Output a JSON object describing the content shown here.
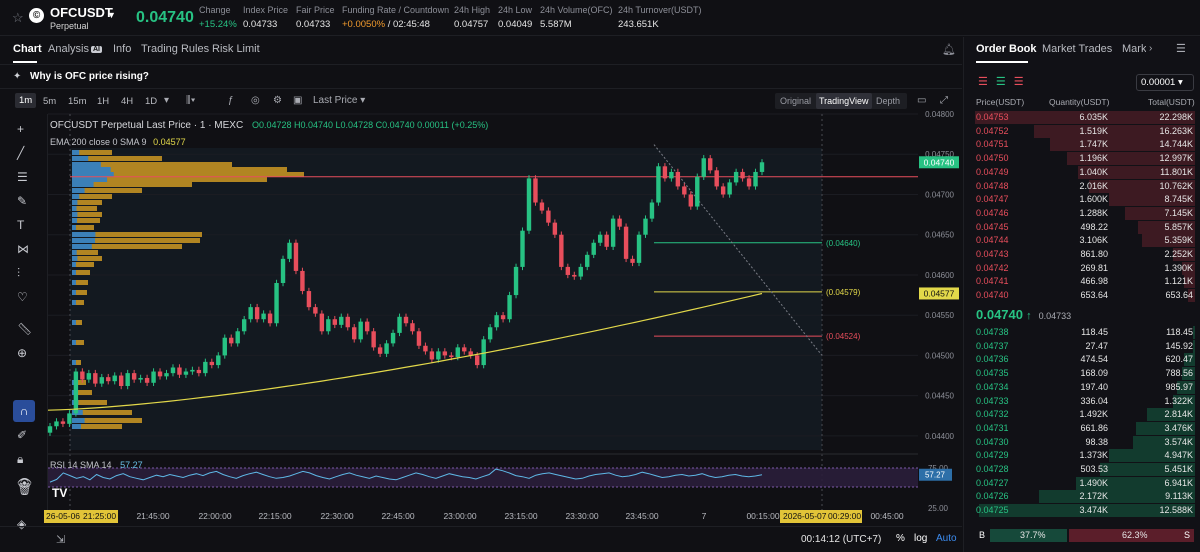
{
  "ticker": {
    "symbol": "OFCUSDT",
    "subtitle": "Perpetual",
    "last_price": "0.04740",
    "stats": [
      {
        "label": "Change",
        "value": "+15.24%",
        "tone": "green"
      },
      {
        "label": "Index Price",
        "value": "0.04733",
        "tone": ""
      },
      {
        "label": "Fair Price",
        "value": "0.04733",
        "tone": ""
      },
      {
        "label": "Funding Rate / Countdown",
        "value": "+0.0050%",
        "value2": "/ 02:45:48",
        "tone": "orange"
      },
      {
        "label": "24h High",
        "value": "0.04757",
        "tone": ""
      },
      {
        "label": "24h Low",
        "value": "0.04049",
        "tone": ""
      },
      {
        "label": "24h Volume(OFC)",
        "value": "5.587M",
        "tone": ""
      },
      {
        "label": "24h Turnover(USDT)",
        "value": "243.651K",
        "tone": ""
      }
    ]
  },
  "chart_tabs": [
    "Chart",
    "Analysis",
    "Info",
    "Trading Rules",
    "Risk Limit"
  ],
  "ai_badge": "AI",
  "info_banner": "Why is OFC price rising?",
  "timeframes": [
    "1m",
    "5m",
    "15m",
    "1H",
    "4H",
    "1D"
  ],
  "price_type": "Last Price",
  "views": [
    "Original",
    "TradingView",
    "Depth"
  ],
  "legend": {
    "title": "OFCUSDT Perpetual Last Price · 1 · MEXC",
    "ohlc": "O0.04728  H0.04740  L0.04728  C0.04740  0.00011 (+0.25%)",
    "ema_label": "EMA 200 close 0 SMA 9",
    "ema_value": "0.04577"
  },
  "rsi": {
    "label": "RSI 14 SMA 14",
    "value": "57.27"
  },
  "chart_data": {
    "type": "candlestick",
    "y_axis_ticks": [
      "0.04800",
      "0.04750",
      "0.04700",
      "0.04650",
      "0.04600",
      "0.04550",
      "0.04500",
      "0.04450",
      "0.04400"
    ],
    "ylim": [
      0.0438,
      0.048
    ],
    "x_axis_ticks": [
      "21:45:00",
      "22:00:00",
      "22:15:00",
      "22:30:00",
      "22:45:00",
      "23:00:00",
      "23:15:00",
      "23:30:00",
      "23:45:00",
      "7",
      "00:15:00",
      "00:45:00"
    ],
    "x_start_label": "26-05-06",
    "x_start_time": "21:25:00",
    "x_cursor_label": "2026-05-07",
    "x_cursor_time": "00:29:00",
    "closes": [
      0.04412,
      0.04418,
      0.04415,
      0.04428,
      0.0448,
      0.0447,
      0.04478,
      0.04465,
      0.04473,
      0.04468,
      0.04475,
      0.04462,
      0.04478,
      0.0447,
      0.04472,
      0.04466,
      0.0448,
      0.04474,
      0.04478,
      0.04485,
      0.04476,
      0.0448,
      0.04482,
      0.04478,
      0.04492,
      0.04488,
      0.045,
      0.04522,
      0.04515,
      0.0453,
      0.04545,
      0.0456,
      0.04545,
      0.04552,
      0.0454,
      0.0459,
      0.0462,
      0.0464,
      0.04605,
      0.0458,
      0.0456,
      0.04552,
      0.0453,
      0.04545,
      0.04538,
      0.04548,
      0.04535,
      0.0452,
      0.04542,
      0.0453,
      0.0451,
      0.04502,
      0.04515,
      0.04528,
      0.04548,
      0.0454,
      0.0453,
      0.04512,
      0.04505,
      0.04495,
      0.04505,
      0.045,
      0.04498,
      0.0451,
      0.04505,
      0.045,
      0.04488,
      0.0452,
      0.04535,
      0.0455,
      0.04545,
      0.04575,
      0.0461,
      0.04655,
      0.0472,
      0.0469,
      0.0468,
      0.04665,
      0.0465,
      0.0461,
      0.046,
      0.04598,
      0.0461,
      0.04625,
      0.0464,
      0.0465,
      0.04635,
      0.0467,
      0.0466,
      0.0462,
      0.04615,
      0.0465,
      0.0467,
      0.0469,
      0.04735,
      0.0472,
      0.04728,
      0.0471,
      0.047,
      0.04685,
      0.04722,
      0.04745,
      0.0473,
      0.0471,
      0.047,
      0.04715,
      0.04728,
      0.0472,
      0.0471,
      0.04728,
      0.0474
    ],
    "ema_end": 0.04577,
    "horizontal_lines": [
      {
        "value": 0.0464,
        "label": "(0.04640)",
        "color": "#27c283"
      },
      {
        "value": 0.04579,
        "label": "(0.04579)",
        "color": "#e2d84a"
      },
      {
        "value": 0.04524,
        "label": "(0.04524)",
        "color": "#e84e5c"
      }
    ],
    "price_tags": [
      {
        "value": 0.0474,
        "label": "0.04740",
        "color": "#27c283"
      },
      {
        "value": 0.04577,
        "label": "0.04577",
        "color": "#e2d84a"
      }
    ],
    "rsi_ticks": [
      "75.00",
      "25.00"
    ],
    "rsi_value": 57.27,
    "rsi_values": [
      38,
      45,
      62,
      55,
      48,
      52,
      44,
      58,
      50,
      46,
      55,
      60,
      52,
      48,
      44,
      50,
      56,
      52,
      58,
      54,
      50,
      56,
      60,
      55,
      62,
      66,
      58,
      52,
      48,
      55,
      60,
      64,
      58,
      52,
      48,
      50,
      54,
      60,
      66,
      62,
      55,
      50,
      46,
      52,
      58,
      62,
      56,
      52,
      48,
      54,
      50,
      46,
      44,
      50,
      56,
      62,
      58,
      52,
      48,
      54,
      60,
      56,
      52,
      50,
      46,
      52,
      58,
      72,
      68,
      62,
      55,
      52,
      48,
      56,
      60,
      62,
      58,
      54,
      50,
      46,
      48,
      54,
      58,
      60,
      62,
      56,
      52,
      54,
      58,
      64,
      60,
      55,
      50,
      52,
      56,
      58,
      54,
      56,
      60,
      54,
      50,
      52,
      56,
      58,
      54,
      52,
      54,
      57
    ]
  },
  "volume_profile_note": "",
  "bottom": {
    "clock": "00:14:12 (UTC+7)",
    "pct": "%",
    "log": "log",
    "auto": "Auto"
  },
  "orderbook": {
    "tabs": [
      "Order Book",
      "Market Trades",
      "Mark"
    ],
    "precision": "0.00001",
    "headers": {
      "price": "Price(USDT)",
      "qty": "Quantity(USDT)",
      "total": "Total(USDT)"
    },
    "asks": [
      {
        "p": "0.04753",
        "q": "6.035K",
        "t": "22.298K",
        "d": 1.0
      },
      {
        "p": "0.04752",
        "q": "1.519K",
        "t": "16.263K",
        "d": 0.73
      },
      {
        "p": "0.04751",
        "q": "1.747K",
        "t": "14.744K",
        "d": 0.66
      },
      {
        "p": "0.04750",
        "q": "1.196K",
        "t": "12.997K",
        "d": 0.58
      },
      {
        "p": "0.04749",
        "q": "1.040K",
        "t": "11.801K",
        "d": 0.53
      },
      {
        "p": "0.04748",
        "q": "2.016K",
        "t": "10.762K",
        "d": 0.48
      },
      {
        "p": "0.04747",
        "q": "1.600K",
        "t": "8.745K",
        "d": 0.39
      },
      {
        "p": "0.04746",
        "q": "1.288K",
        "t": "7.145K",
        "d": 0.32
      },
      {
        "p": "0.04745",
        "q": "498.22",
        "t": "5.857K",
        "d": 0.26
      },
      {
        "p": "0.04744",
        "q": "3.106K",
        "t": "5.359K",
        "d": 0.24
      },
      {
        "p": "0.04743",
        "q": "861.80",
        "t": "2.252K",
        "d": 0.1
      },
      {
        "p": "0.04742",
        "q": "269.81",
        "t": "1.390K",
        "d": 0.06
      },
      {
        "p": "0.04741",
        "q": "466.98",
        "t": "1.121K",
        "d": 0.05
      },
      {
        "p": "0.04740",
        "q": "653.64",
        "t": "653.64",
        "d": 0.03
      }
    ],
    "mid_price": "0.04740",
    "mid_arrow": "↑",
    "mid_index": "0.04733",
    "bids": [
      {
        "p": "0.04738",
        "q": "118.45",
        "t": "118.45",
        "d": 0.01
      },
      {
        "p": "0.04737",
        "q": "27.47",
        "t": "145.92",
        "d": 0.01
      },
      {
        "p": "0.04736",
        "q": "474.54",
        "t": "620.47",
        "d": 0.05
      },
      {
        "p": "0.04735",
        "q": "168.09",
        "t": "788.56",
        "d": 0.06
      },
      {
        "p": "0.04734",
        "q": "197.40",
        "t": "985.97",
        "d": 0.08
      },
      {
        "p": "0.04733",
        "q": "336.04",
        "t": "1.322K",
        "d": 0.1
      },
      {
        "p": "0.04732",
        "q": "1.492K",
        "t": "2.814K",
        "d": 0.22
      },
      {
        "p": "0.04731",
        "q": "661.86",
        "t": "3.476K",
        "d": 0.27
      },
      {
        "p": "0.04730",
        "q": "98.38",
        "t": "3.574K",
        "d": 0.28
      },
      {
        "p": "0.04729",
        "q": "1.373K",
        "t": "4.947K",
        "d": 0.39
      },
      {
        "p": "0.04728",
        "q": "503.53",
        "t": "5.451K",
        "d": 0.43
      },
      {
        "p": "0.04727",
        "q": "1.490K",
        "t": "6.941K",
        "d": 0.54
      },
      {
        "p": "0.04726",
        "q": "2.172K",
        "t": "9.113K",
        "d": 0.71
      },
      {
        "p": "0.04725",
        "q": "3.474K",
        "t": "12.588K",
        "d": 0.98
      }
    ],
    "buy_label": "B",
    "sell_label": "S",
    "buy_pct": "37.7%",
    "sell_pct": "62.3%",
    "buy_ratio": 0.377
  }
}
